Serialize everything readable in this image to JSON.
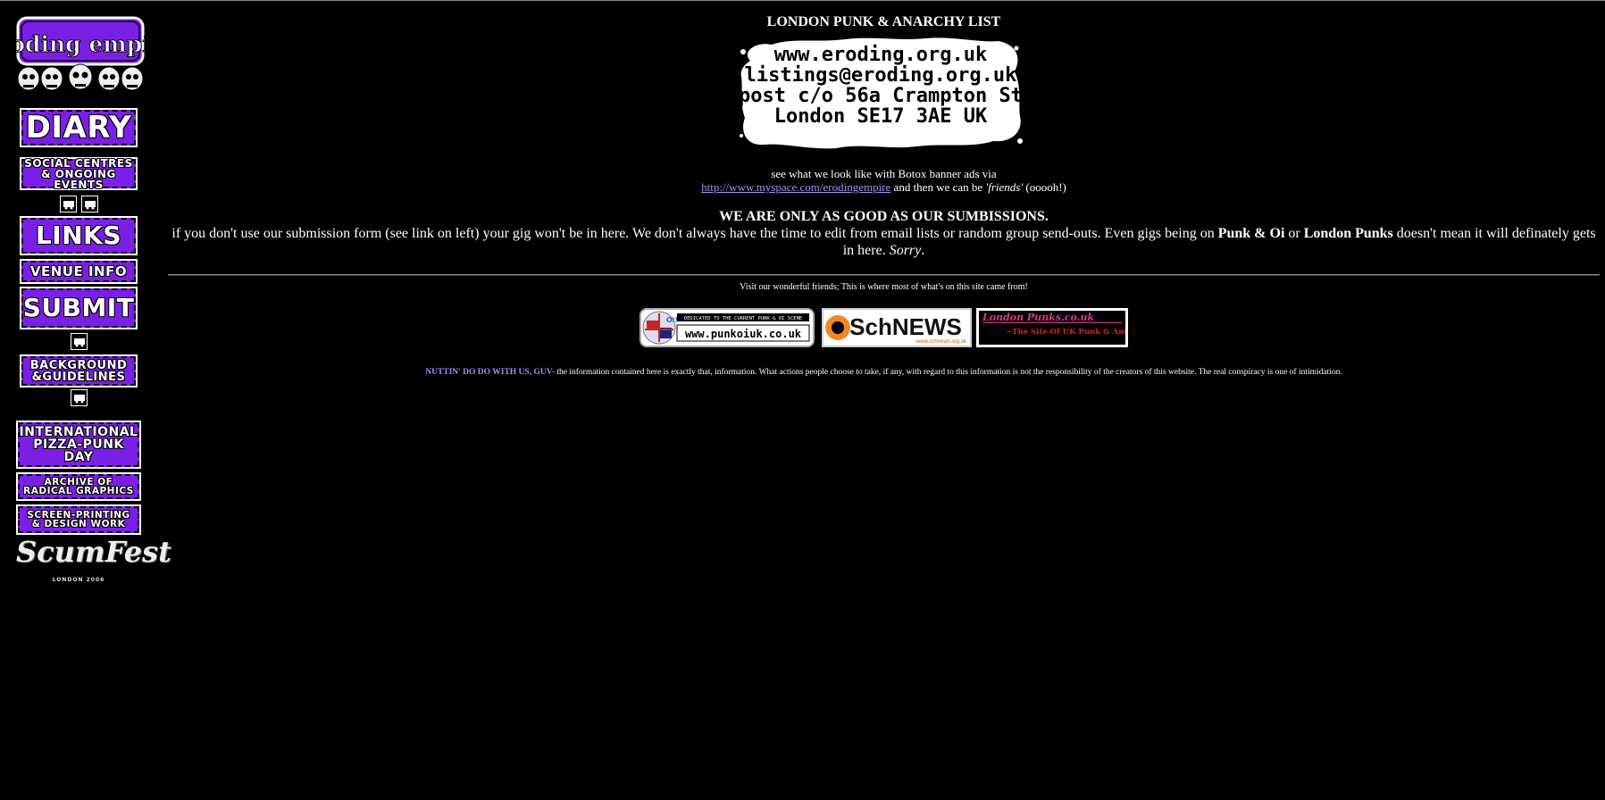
{
  "sidebar": {
    "logo_text": "eroding empire",
    "nav": [
      {
        "label": "DIARY"
      },
      {
        "label": "SOCIAL CENTRES\n& ONGOING EVENTS"
      },
      {
        "label": "LINKS"
      },
      {
        "label": "VENUE INFO"
      },
      {
        "label": "SUBMIT"
      },
      {
        "label": "BACKGROUND\n&GUIDELINES"
      },
      {
        "label": "INTERNATIONAL\nPIZZA-PUNK\nDAY"
      },
      {
        "label": "ARCHIVE OF\nRADICAL GRAPHICS"
      },
      {
        "label": "SCREEN-PRINTING\n& DESIGN WORK"
      }
    ],
    "scumfest": {
      "label": "ScumFest",
      "sub": "LONDON 2006"
    }
  },
  "main": {
    "title": "LONDON PUNK & ANARCHY LIST",
    "stamp_lines": [
      "www.eroding.org.uk",
      "listings@eroding.org.uk",
      "post c/o 56a Crampton St",
      "London SE17 3AE UK"
    ],
    "promo_line1": "see what we look like with Botox banner ads via",
    "promo_link": "http://www.myspace.com/erodingempire",
    "promo_after": " and then we can be ",
    "promo_friends": "'friends'",
    "promo_end": " (ooooh!)",
    "heading2": "WE ARE ONLY AS GOOD AS OUR SUMBISSIONS.",
    "para_part1": "if you don't use our submission form (see link on left) your gig won't be in here. We don't always have the time to edit from email lists or random group send-outs. Even gigs being on ",
    "para_bold1": "Punk & Oi",
    "para_part2": " or ",
    "para_bold2": "London Punks",
    "para_part3": " doesn't mean it will definately gets in here. ",
    "para_sorry": "Sorry",
    "para_end": ".",
    "friends_text": "Visit our wonderful friends; This is where most of what's on this site came from!",
    "banners": [
      {
        "label": "www.punkoiuk.co.uk",
        "tagline": "DEDICATED TO THE CURRENT PUNK & OI SCENE",
        "badge": "Oi!"
      },
      {
        "label": "SchNEWS",
        "sub": "www.schnews.org.uk"
      },
      {
        "label": "London Punks.co.uk",
        "sub": "~The Site Of UK Punk & Animal Rights."
      }
    ],
    "disclaimer_guv": "NUTTIN' DO DO WITH US, GUV-",
    "disclaimer_text": " the information contained here is exactly that, information. What actions people choose to take, if any, with regard to this information is not the responsibility of the creators of this website. The real conspiracy is one of intimidation."
  }
}
